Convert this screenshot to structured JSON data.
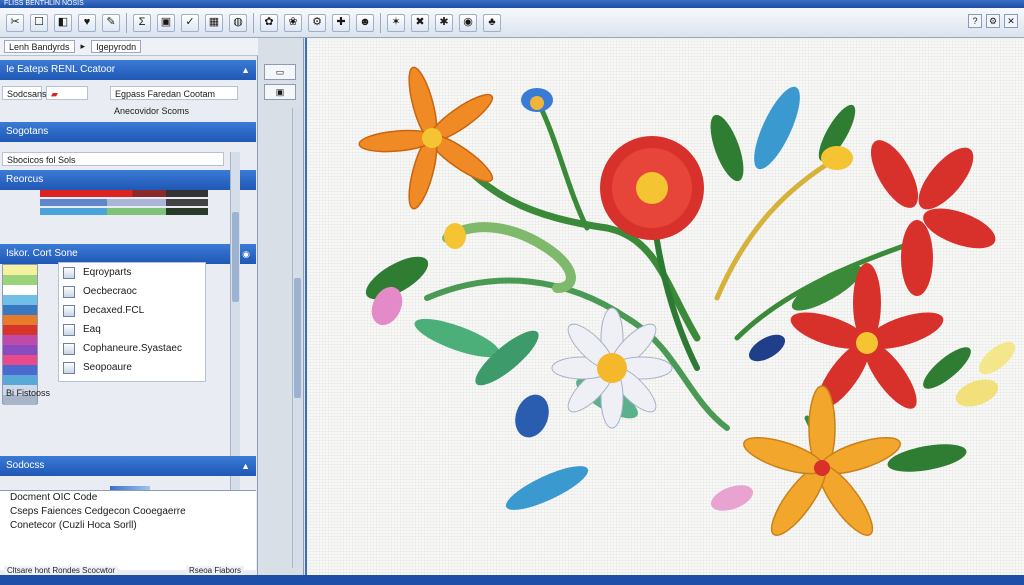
{
  "window": {
    "title": "FLISS BENTHLIN NOSIS"
  },
  "toolbar": {
    "buttons": [
      "✂",
      "☐",
      "◧",
      "♥",
      "✎",
      "Σ",
      "▣",
      "✓",
      "▦",
      "◍",
      "✿",
      "❀",
      "⚙",
      "✚",
      "☻",
      "✶",
      "✖",
      "✱",
      "◉",
      "♣"
    ]
  },
  "toolbar2": {
    "field1": "Lenh Bandyrds",
    "field2": "Igepyrodn"
  },
  "left_panel": {
    "header1": "Ie Eateps RENL Ccatoor",
    "row1a": "Sodcsans",
    "row1b": "Egpass Faredan Cootam",
    "row1c": "Anecovidor Scoms",
    "header2": "Sogotans",
    "row2": "Sbocicos   fol   Sols",
    "header3": "Reorcus",
    "header4": "Iskor. Cort Sone",
    "list_items": [
      "Eqroyparts",
      "Oecbecraoc",
      "Decaxed.FCL",
      "Eaq",
      "Cophaneure.Syastaec",
      "Seopoaure"
    ],
    "row_footer": "Bi Fistooss",
    "header5": "Sodocss",
    "footer_lines": [
      "Docment OIC Code",
      "Cseps Faiences Cedgecon Cooegaerre",
      "Conetecor (Cuzli Hoca Sorll)"
    ]
  },
  "status": {
    "left": "Cltsare hont Rondes Scocwtor",
    "right": "Rseoa Fiabors"
  },
  "colors": {
    "accent": "#1f57b5",
    "title": "#1d4fa8"
  }
}
